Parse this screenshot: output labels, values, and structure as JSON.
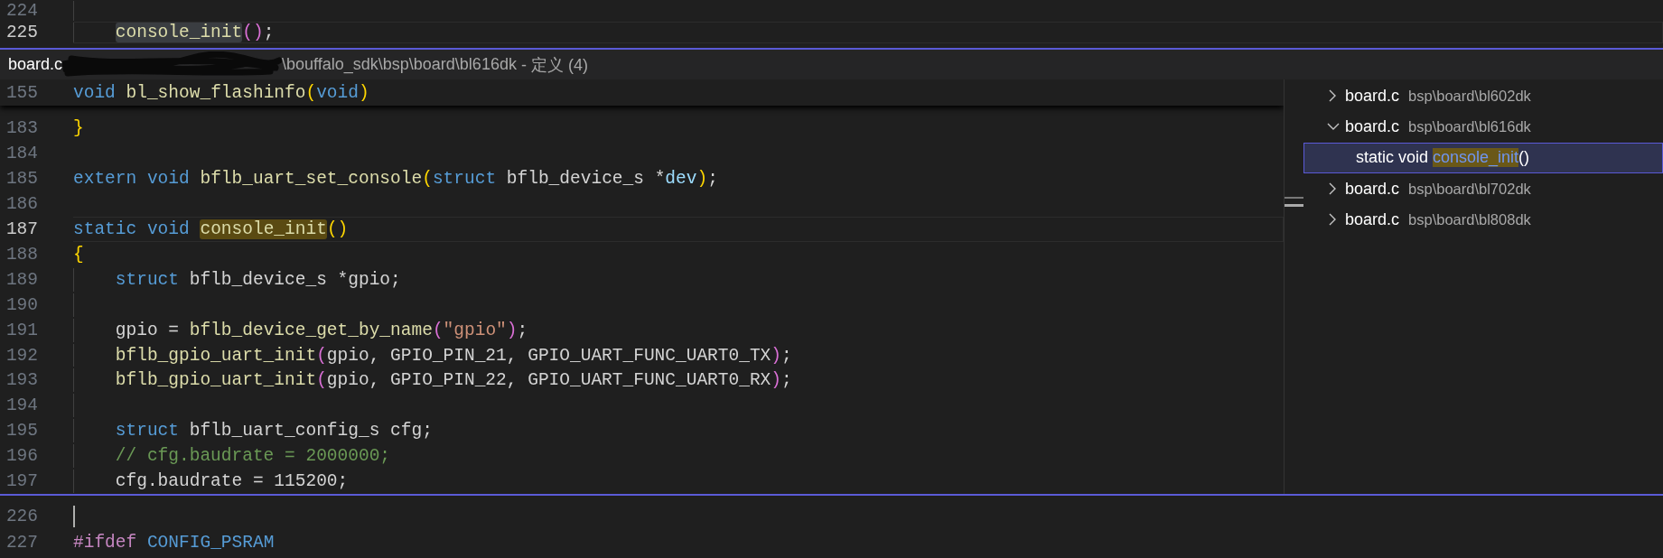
{
  "editor": {
    "lines_above": [
      {
        "number": "224",
        "current": false,
        "indented": true
      },
      {
        "number": "225",
        "current": true,
        "indented": true,
        "tokens": [
          {
            "kind": "fn",
            "text": "console_init",
            "highlighted": true
          },
          {
            "kind": "b2",
            "text": "()"
          },
          {
            "kind": "plain",
            "text": ";"
          }
        ]
      }
    ],
    "peek": {
      "title": {
        "filename": "board.c",
        "path": "\\bouffalo_sdk\\bsp\\board\\bl616dk",
        "suffix": "- 定义 (4)"
      },
      "sticky_line": {
        "number": "155",
        "current": false,
        "tokens": [
          {
            "kind": "kw",
            "text": "void "
          },
          {
            "kind": "fn",
            "text": "bl_show_flashinfo"
          },
          {
            "kind": "b1",
            "text": "("
          },
          {
            "kind": "kw",
            "text": "void"
          },
          {
            "kind": "b1",
            "text": ")"
          }
        ]
      },
      "lines": [
        {
          "number": "183",
          "current": false,
          "tokens": [
            {
              "kind": "b1",
              "text": "}"
            }
          ]
        },
        {
          "number": "184",
          "current": false
        },
        {
          "number": "185",
          "current": false,
          "tokens": [
            {
              "kind": "kw",
              "text": "extern "
            },
            {
              "kind": "kw",
              "text": "void "
            },
            {
              "kind": "fn",
              "text": "bflb_uart_set_console"
            },
            {
              "kind": "b1",
              "text": "("
            },
            {
              "kind": "kw",
              "text": "struct "
            },
            {
              "kind": "plain",
              "text": "bflb_device_s *"
            },
            {
              "kind": "var",
              "text": "dev"
            },
            {
              "kind": "b1",
              "text": ")"
            },
            {
              "kind": "plain",
              "text": ";"
            }
          ]
        },
        {
          "number": "186",
          "current": false
        },
        {
          "number": "187",
          "current": true,
          "tokens": [
            {
              "kind": "kw",
              "text": "static "
            },
            {
              "kind": "kw",
              "text": "void "
            },
            {
              "kind": "fn",
              "text": "console_init",
              "highlighted": true
            },
            {
              "kind": "b1",
              "text": "()"
            }
          ]
        },
        {
          "number": "188",
          "current": false,
          "tokens": [
            {
              "kind": "b1",
              "text": "{"
            }
          ]
        },
        {
          "number": "189",
          "current": false,
          "indented": true,
          "tokens": [
            {
              "kind": "kw",
              "text": "struct "
            },
            {
              "kind": "plain",
              "text": "bflb_device_s *gpio;"
            }
          ]
        },
        {
          "number": "190",
          "current": false,
          "indented": true
        },
        {
          "number": "191",
          "current": false,
          "indented": true,
          "tokens": [
            {
              "kind": "plain",
              "text": "gpio = "
            },
            {
              "kind": "fn",
              "text": "bflb_device_get_by_name"
            },
            {
              "kind": "b2",
              "text": "("
            },
            {
              "kind": "str",
              "text": "\"gpio\""
            },
            {
              "kind": "b2",
              "text": ")"
            },
            {
              "kind": "plain",
              "text": ";"
            }
          ]
        },
        {
          "number": "192",
          "current": false,
          "indented": true,
          "tokens": [
            {
              "kind": "fn",
              "text": "bflb_gpio_uart_init"
            },
            {
              "kind": "b2",
              "text": "("
            },
            {
              "kind": "plain",
              "text": "gpio, GPIO_PIN_21, GPIO_UART_FUNC_UART0_TX"
            },
            {
              "kind": "b2",
              "text": ")"
            },
            {
              "kind": "plain",
              "text": ";"
            }
          ]
        },
        {
          "number": "193",
          "current": false,
          "indented": true,
          "tokens": [
            {
              "kind": "fn",
              "text": "bflb_gpio_uart_init"
            },
            {
              "kind": "b2",
              "text": "("
            },
            {
              "kind": "plain",
              "text": "gpio, GPIO_PIN_22, GPIO_UART_FUNC_UART0_RX"
            },
            {
              "kind": "b2",
              "text": ")"
            },
            {
              "kind": "plain",
              "text": ";"
            }
          ]
        },
        {
          "number": "194",
          "current": false,
          "indented": true
        },
        {
          "number": "195",
          "current": false,
          "indented": true,
          "tokens": [
            {
              "kind": "kw",
              "text": "struct "
            },
            {
              "kind": "plain",
              "text": "bflb_uart_config_s cfg;"
            }
          ]
        },
        {
          "number": "196",
          "current": false,
          "indented": true,
          "tokens": [
            {
              "kind": "comment",
              "text": "// cfg.baudrate = 2000000;"
            }
          ]
        },
        {
          "number": "197",
          "current": false,
          "indented": true,
          "tokens": [
            {
              "kind": "plain",
              "text": "cfg.baudrate = 115200;"
            }
          ]
        }
      ],
      "references": [
        {
          "filename": "board.c",
          "path": "bsp\\board\\bl602dk",
          "expanded": false
        },
        {
          "filename": "board.c",
          "path": "bsp\\board\\bl616dk",
          "expanded": true,
          "children": [
            {
              "prefix": "static void",
              "match": "console_init",
              "suffix": "()",
              "selected": true
            }
          ]
        },
        {
          "filename": "board.c",
          "path": "bsp\\board\\bl702dk",
          "expanded": false
        },
        {
          "filename": "board.c",
          "path": "bsp\\board\\bl808dk",
          "expanded": false
        }
      ]
    },
    "lines_below": [
      {
        "number": "226",
        "current": false,
        "cursor": true
      },
      {
        "number": "227",
        "current": false,
        "tokens": [
          {
            "kind": "pp",
            "text": "#ifdef "
          },
          {
            "kind": "macro",
            "text": "CONFIG_PSRAM"
          }
        ]
      }
    ]
  }
}
